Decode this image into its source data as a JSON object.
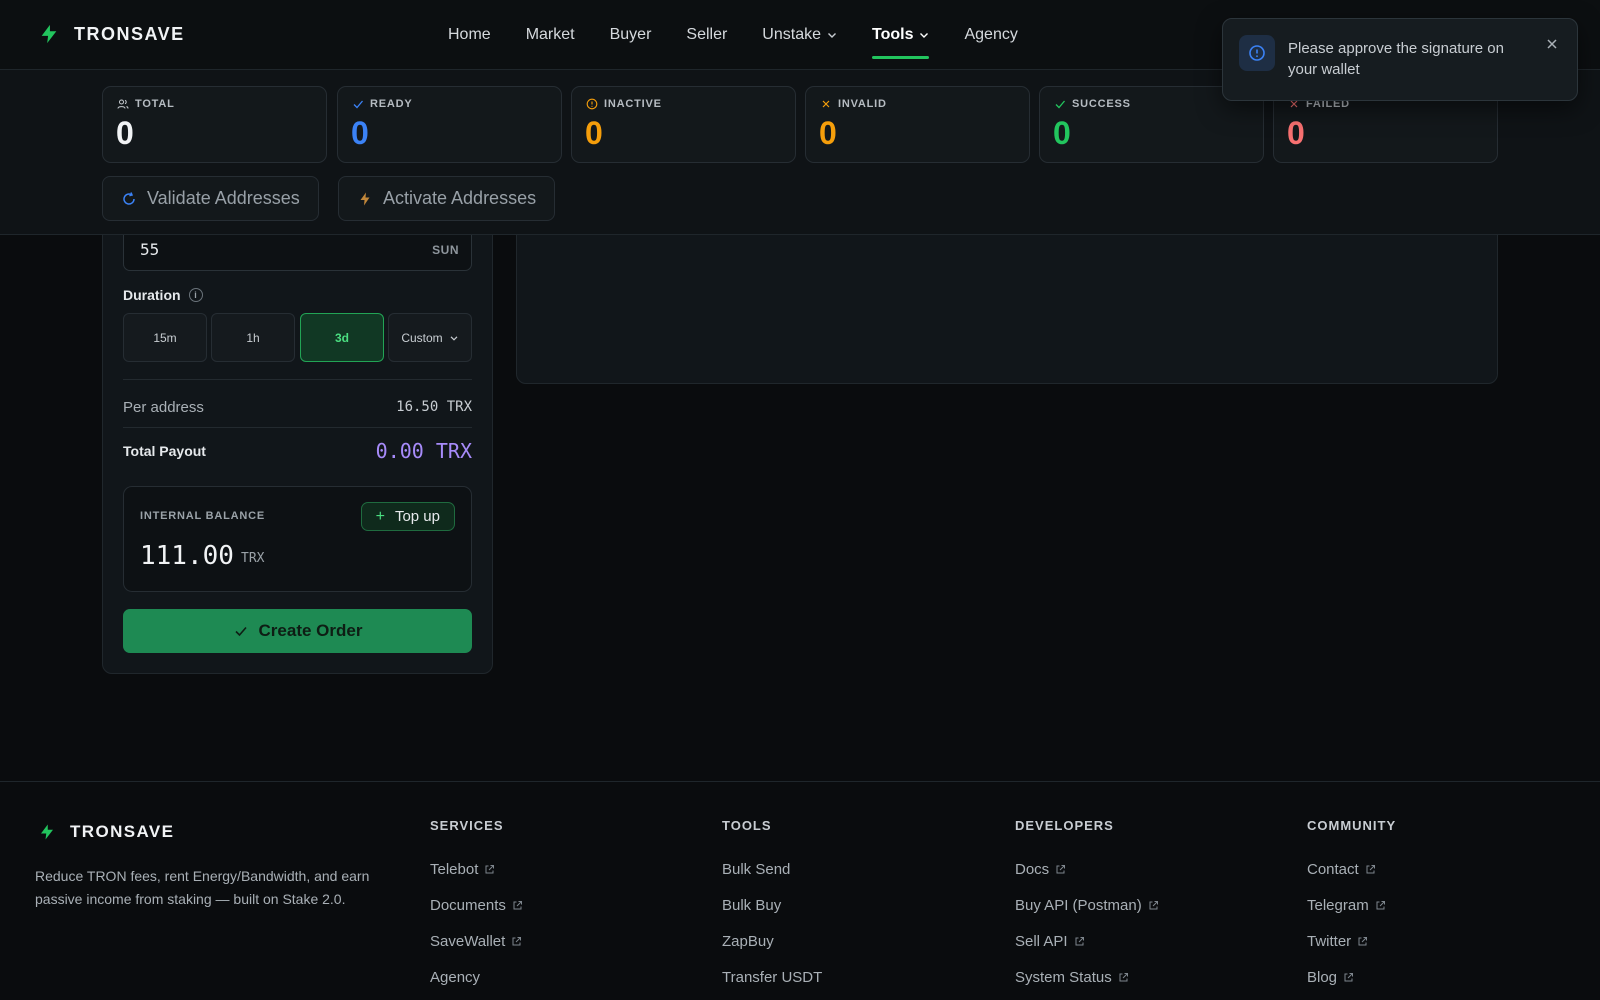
{
  "header": {
    "brand": "TRONSAVE",
    "nav": [
      {
        "label": "Home",
        "active": false,
        "dropdown": false
      },
      {
        "label": "Market",
        "active": false,
        "dropdown": false
      },
      {
        "label": "Buyer",
        "active": false,
        "dropdown": false
      },
      {
        "label": "Seller",
        "active": false,
        "dropdown": false
      },
      {
        "label": "Unstake",
        "active": false,
        "dropdown": true
      },
      {
        "label": "Tools",
        "active": true,
        "dropdown": true
      },
      {
        "label": "Agency",
        "active": false,
        "dropdown": false
      }
    ]
  },
  "toast": {
    "message": "Please approve the signature on your wallet",
    "icon": "info-icon"
  },
  "stats": {
    "total": {
      "label": "TOTAL",
      "value": "0",
      "color": "#f1f3f5",
      "icon": "users-icon"
    },
    "ready": {
      "label": "READY",
      "value": "0",
      "color": "#3b82f6",
      "icon": "check-icon"
    },
    "inactive": {
      "label": "INACTIVE",
      "value": "0",
      "color": "#f59e0b",
      "icon": "info-icon"
    },
    "invalid": {
      "label": "INVALID",
      "value": "0",
      "color": "#f59e0b",
      "icon": "x-icon"
    },
    "success": {
      "label": "SUCCESS",
      "value": "0",
      "color": "#22c55e",
      "icon": "check-icon"
    },
    "failed": {
      "label": "FAILED",
      "value": "0",
      "color": "#f87171",
      "icon": "x-icon"
    }
  },
  "actions": {
    "validate": "Validate Addresses",
    "activate": "Activate Addresses"
  },
  "order": {
    "price_value": "55",
    "price_unit": "SUN",
    "duration_label": "Duration",
    "duration_info": "i",
    "durations": [
      "15m",
      "1h",
      "3d"
    ],
    "duration_selected": "3d",
    "custom_label": "Custom",
    "per_address_label": "Per address",
    "per_address_value": "16.50 TRX",
    "total_label": "Total Payout",
    "total_value": "0.00 TRX",
    "balance_label": "INTERNAL BALANCE",
    "topup_label": "Top up",
    "balance_value": "111.00",
    "balance_unit": "TRX",
    "create_label": "Create Order"
  },
  "footer": {
    "brand": "TRONSAVE",
    "description": "Reduce TRON fees, rent Energy/Bandwidth, and earn passive income from staking — built on Stake 2.0.",
    "columns": [
      {
        "title": "SERVICES",
        "links": [
          {
            "label": "Telebot",
            "external": true
          },
          {
            "label": "Documents",
            "external": true
          },
          {
            "label": "SaveWallet",
            "external": true
          },
          {
            "label": "Agency",
            "external": false
          }
        ]
      },
      {
        "title": "TOOLS",
        "links": [
          {
            "label": "Bulk Send",
            "external": false
          },
          {
            "label": "Bulk Buy",
            "external": false
          },
          {
            "label": "ZapBuy",
            "external": false
          },
          {
            "label": "Transfer USDT",
            "external": false
          }
        ]
      },
      {
        "title": "DEVELOPERS",
        "links": [
          {
            "label": "Docs",
            "external": true
          },
          {
            "label": "Buy API (Postman)",
            "external": true
          },
          {
            "label": "Sell API",
            "external": true
          },
          {
            "label": "System Status",
            "external": true
          }
        ]
      },
      {
        "title": "COMMUNITY",
        "links": [
          {
            "label": "Contact",
            "external": true
          },
          {
            "label": "Telegram",
            "external": true
          },
          {
            "label": "Twitter",
            "external": true
          },
          {
            "label": "Blog",
            "external": true
          }
        ]
      }
    ]
  },
  "colors": {
    "accent": "#22c55e",
    "button_green": "#1e8a53",
    "total_purple": "#a78bfa"
  }
}
